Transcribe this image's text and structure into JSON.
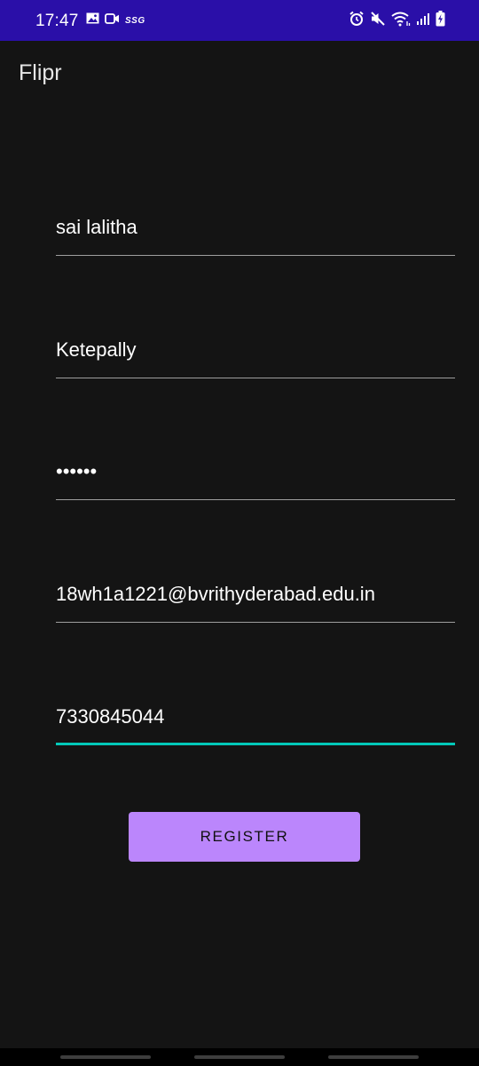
{
  "status_bar": {
    "time": "17:47",
    "network_label": "SSG",
    "background_color": "#2a0fa8",
    "left_icons": [
      "gallery-icon",
      "video-icon"
    ],
    "right_icons": [
      "alarm-icon",
      "mute-icon",
      "wifi-icon",
      "signal-icon",
      "battery-icon"
    ]
  },
  "app_bar": {
    "title": "Flipr"
  },
  "form": {
    "first_name": {
      "value": "sai lalitha"
    },
    "last_name": {
      "value": "Ketepally"
    },
    "password": {
      "value": "••••••"
    },
    "email": {
      "value": "18wh1a1221@bvrithyderabad.edu.in"
    },
    "phone": {
      "value": "7330845044",
      "focused": true
    },
    "register_label": "REGISTER",
    "accent_color": "#03c9b9",
    "button_color": "#bb86fc"
  },
  "nav_bar": {
    "buttons": [
      "recent-apps-button",
      "home-button",
      "back-button"
    ]
  }
}
